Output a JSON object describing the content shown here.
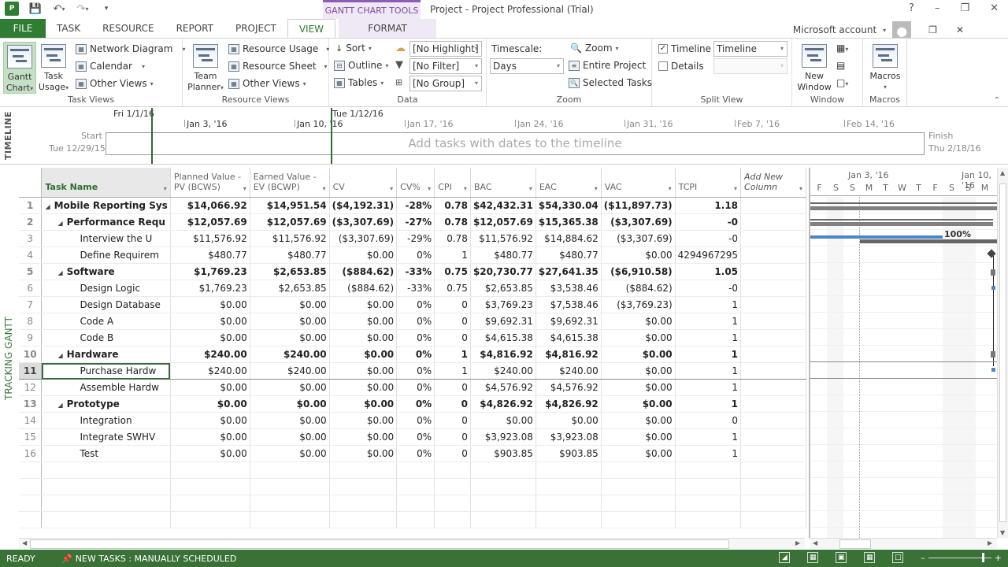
{
  "titlebar": {
    "app_title": "Project - Project Professional (Trial)",
    "context_tab_group": "GANTT CHART TOOLS",
    "account": "Microsoft account",
    "icons": [
      "project-app-icon",
      "save-icon",
      "undo-icon",
      "redo-icon",
      "customize-qat-icon"
    ],
    "window_controls": [
      "help-icon",
      "minimize-icon",
      "restore-icon",
      "close-icon"
    ]
  },
  "tabs": [
    {
      "label": "FILE"
    },
    {
      "label": "TASK"
    },
    {
      "label": "RESOURCE"
    },
    {
      "label": "REPORT"
    },
    {
      "label": "PROJECT"
    },
    {
      "label": "VIEW",
      "active": true
    },
    {
      "label": "FORMAT",
      "contextual": true
    }
  ],
  "ribbon": {
    "task_views": {
      "label": "Task Views",
      "gantt_chart": "Gantt Chart",
      "gantt_line1": "Gantt",
      "gantt_line2": "Chart",
      "task_usage_line1": "Task",
      "task_usage_line2": "Usage",
      "network_diagram": "Network Diagram",
      "calendar": "Calendar",
      "other_views": "Other Views"
    },
    "resource_views": {
      "label": "Resource Views",
      "team_planner_line1": "Team",
      "team_planner_line2": "Planner",
      "resource_usage": "Resource Usage",
      "resource_sheet": "Resource Sheet",
      "other_views": "Other Views"
    },
    "data": {
      "label": "Data",
      "sort": "Sort",
      "outline": "Outline",
      "tables": "Tables",
      "highlight": "[No Highlight]",
      "filter": "[No Filter]",
      "group": "[No Group]"
    },
    "zoom": {
      "label": "Zoom",
      "timescale_label": "Timescale:",
      "timescale_value": "Days",
      "zoom": "Zoom",
      "entire_project": "Entire Project",
      "selected_tasks": "Selected Tasks"
    },
    "split_view": {
      "label": "Split View",
      "timeline_label": "Timeline",
      "timeline_checked": true,
      "timeline_value": "Timeline",
      "details_label": "Details",
      "details_checked": false,
      "details_value": ""
    },
    "window": {
      "label": "Window",
      "new_window_line1": "New",
      "new_window_line2": "Window"
    },
    "macros": {
      "label": "Macros",
      "macros": "Macros"
    }
  },
  "timeline": {
    "side_label": "TIMELINE",
    "start_label": "Start",
    "start_date": "Tue 12/29/15",
    "finish_label": "Finish",
    "finish_date": "Thu 2/18/16",
    "marker_left": "Fri 1/1/16",
    "marker_right": "Tue 1/12/16",
    "weeks": [
      "Jan 3, '16",
      "Jan 10, '16",
      "Jan 17, '16",
      "Jan 24, '16",
      "Jan 31, '16",
      "Feb 7, '16",
      "Feb 14, '16"
    ],
    "hint": "Add tasks with dates to the timeline"
  },
  "view_label": "TRACKING GANTT",
  "table": {
    "columns": [
      {
        "key": "name",
        "label": "Task Name"
      },
      {
        "key": "pv",
        "label": "Planned Value - PV (BCWS)"
      },
      {
        "key": "ev",
        "label": "Earned Value - EV (BCWP)"
      },
      {
        "key": "cv",
        "label": "CV"
      },
      {
        "key": "cvp",
        "label": "CV%"
      },
      {
        "key": "cpi",
        "label": "CPI"
      },
      {
        "key": "bac",
        "label": "BAC"
      },
      {
        "key": "eac",
        "label": "EAC"
      },
      {
        "key": "vac",
        "label": "VAC"
      },
      {
        "key": "tcpi",
        "label": "TCPI"
      },
      {
        "key": "add",
        "label": "Add New Column"
      }
    ],
    "rows": [
      {
        "id": "1",
        "level": 0,
        "summary": true,
        "name": "Mobile Reporting Sys",
        "pv": "$14,066.92",
        "ev": "$14,951.54",
        "cv": "($4,192.31)",
        "cvp": "-28%",
        "cpi": "0.78",
        "bac": "$42,432.31",
        "eac": "$54,330.04",
        "vac": "($11,897.73)",
        "tcpi": "1.18"
      },
      {
        "id": "2",
        "level": 1,
        "summary": true,
        "name": "Performance Requ",
        "pv": "$12,057.69",
        "ev": "$12,057.69",
        "cv": "($3,307.69)",
        "cvp": "-27%",
        "cpi": "0.78",
        "bac": "$12,057.69",
        "eac": "$15,365.38",
        "vac": "($3,307.69)",
        "tcpi": "-0"
      },
      {
        "id": "3",
        "level": 2,
        "summary": false,
        "name": "Interview the U",
        "pv": "$11,576.92",
        "ev": "$11,576.92",
        "cv": "($3,307.69)",
        "cvp": "-29%",
        "cpi": "0.78",
        "bac": "$11,576.92",
        "eac": "$14,884.62",
        "vac": "($3,307.69)",
        "tcpi": "-0"
      },
      {
        "id": "4",
        "level": 2,
        "summary": false,
        "name": "Define Requirem",
        "pv": "$480.77",
        "ev": "$480.77",
        "cv": "$0.00",
        "cvp": "0%",
        "cpi": "1",
        "bac": "$480.77",
        "eac": "$480.77",
        "vac": "$0.00",
        "tcpi": "4294967295"
      },
      {
        "id": "5",
        "level": 1,
        "summary": true,
        "name": "Software",
        "pv": "$1,769.23",
        "ev": "$2,653.85",
        "cv": "($884.62)",
        "cvp": "-33%",
        "cpi": "0.75",
        "bac": "$20,730.77",
        "eac": "$27,641.35",
        "vac": "($6,910.58)",
        "tcpi": "1.05"
      },
      {
        "id": "6",
        "level": 2,
        "summary": false,
        "name": "Design Logic",
        "pv": "$1,769.23",
        "ev": "$2,653.85",
        "cv": "($884.62)",
        "cvp": "-33%",
        "cpi": "0.75",
        "bac": "$2,653.85",
        "eac": "$3,538.46",
        "vac": "($884.62)",
        "tcpi": "-0"
      },
      {
        "id": "7",
        "level": 2,
        "summary": false,
        "name": "Design Database",
        "pv": "$0.00",
        "ev": "$0.00",
        "cv": "$0.00",
        "cvp": "0%",
        "cpi": "0",
        "bac": "$3,769.23",
        "eac": "$7,538.46",
        "vac": "($3,769.23)",
        "tcpi": "1"
      },
      {
        "id": "8",
        "level": 2,
        "summary": false,
        "name": "Code A",
        "pv": "$0.00",
        "ev": "$0.00",
        "cv": "$0.00",
        "cvp": "0%",
        "cpi": "0",
        "bac": "$9,692.31",
        "eac": "$9,692.31",
        "vac": "$0.00",
        "tcpi": "1"
      },
      {
        "id": "9",
        "level": 2,
        "summary": false,
        "name": "Code B",
        "pv": "$0.00",
        "ev": "$0.00",
        "cv": "$0.00",
        "cvp": "0%",
        "cpi": "0",
        "bac": "$4,615.38",
        "eac": "$4,615.38",
        "vac": "$0.00",
        "tcpi": "1"
      },
      {
        "id": "10",
        "level": 1,
        "summary": true,
        "name": "Hardware",
        "pv": "$240.00",
        "ev": "$240.00",
        "cv": "$0.00",
        "cvp": "0%",
        "cpi": "1",
        "bac": "$4,816.92",
        "eac": "$4,816.92",
        "vac": "$0.00",
        "tcpi": "1"
      },
      {
        "id": "11",
        "level": 2,
        "summary": false,
        "selected": true,
        "name": "Purchase Hardw",
        "pv": "$240.00",
        "ev": "$240.00",
        "cv": "$0.00",
        "cvp": "0%",
        "cpi": "1",
        "bac": "$240.00",
        "eac": "$240.00",
        "vac": "$0.00",
        "tcpi": "1"
      },
      {
        "id": "12",
        "level": 2,
        "summary": false,
        "name": "Assemble Hardw",
        "pv": "$0.00",
        "ev": "$0.00",
        "cv": "$0.00",
        "cvp": "0%",
        "cpi": "0",
        "bac": "$4,576.92",
        "eac": "$4,576.92",
        "vac": "$0.00",
        "tcpi": "1"
      },
      {
        "id": "13",
        "level": 1,
        "summary": true,
        "name": "Prototype",
        "pv": "$0.00",
        "ev": "$0.00",
        "cv": "$0.00",
        "cvp": "0%",
        "cpi": "0",
        "bac": "$4,826.92",
        "eac": "$4,826.92",
        "vac": "$0.00",
        "tcpi": "1"
      },
      {
        "id": "14",
        "level": 2,
        "summary": false,
        "name": "Integration",
        "pv": "$0.00",
        "ev": "$0.00",
        "cv": "$0.00",
        "cvp": "0%",
        "cpi": "0",
        "bac": "$0.00",
        "eac": "$0.00",
        "vac": "$0.00",
        "tcpi": "0"
      },
      {
        "id": "15",
        "level": 2,
        "summary": false,
        "name": "Integrate SWHV",
        "pv": "$0.00",
        "ev": "$0.00",
        "cv": "$0.00",
        "cvp": "0%",
        "cpi": "0",
        "bac": "$3,923.08",
        "eac": "$3,923.08",
        "vac": "$0.00",
        "tcpi": "1"
      },
      {
        "id": "16",
        "level": 2,
        "summary": false,
        "name": "Test",
        "pv": "$0.00",
        "ev": "$0.00",
        "cv": "$0.00",
        "cvp": "0%",
        "cpi": "0",
        "bac": "$903.85",
        "eac": "$903.85",
        "vac": "$0.00",
        "tcpi": "1"
      }
    ]
  },
  "gantt": {
    "weeks": [
      "Jan 3, '16",
      "Jan 10, '16"
    ],
    "days": [
      "F",
      "S",
      "S",
      "M",
      "T",
      "W",
      "T",
      "F",
      "S",
      "S",
      "M"
    ],
    "progress_label": "100%",
    "colors": {
      "summary": "#666666",
      "progress": "#4a86c8",
      "baseline": "#808080"
    }
  },
  "status": {
    "ready": "READY",
    "new_tasks": "NEW TASKS : MANUALLY SCHEDULED",
    "icons": [
      "gantt-view-icon",
      "task-usage-view-icon",
      "team-planner-view-icon",
      "resource-sheet-view-icon",
      "report-view-icon"
    ],
    "zoom_level": 0.85
  },
  "accent": "#2e7d32"
}
